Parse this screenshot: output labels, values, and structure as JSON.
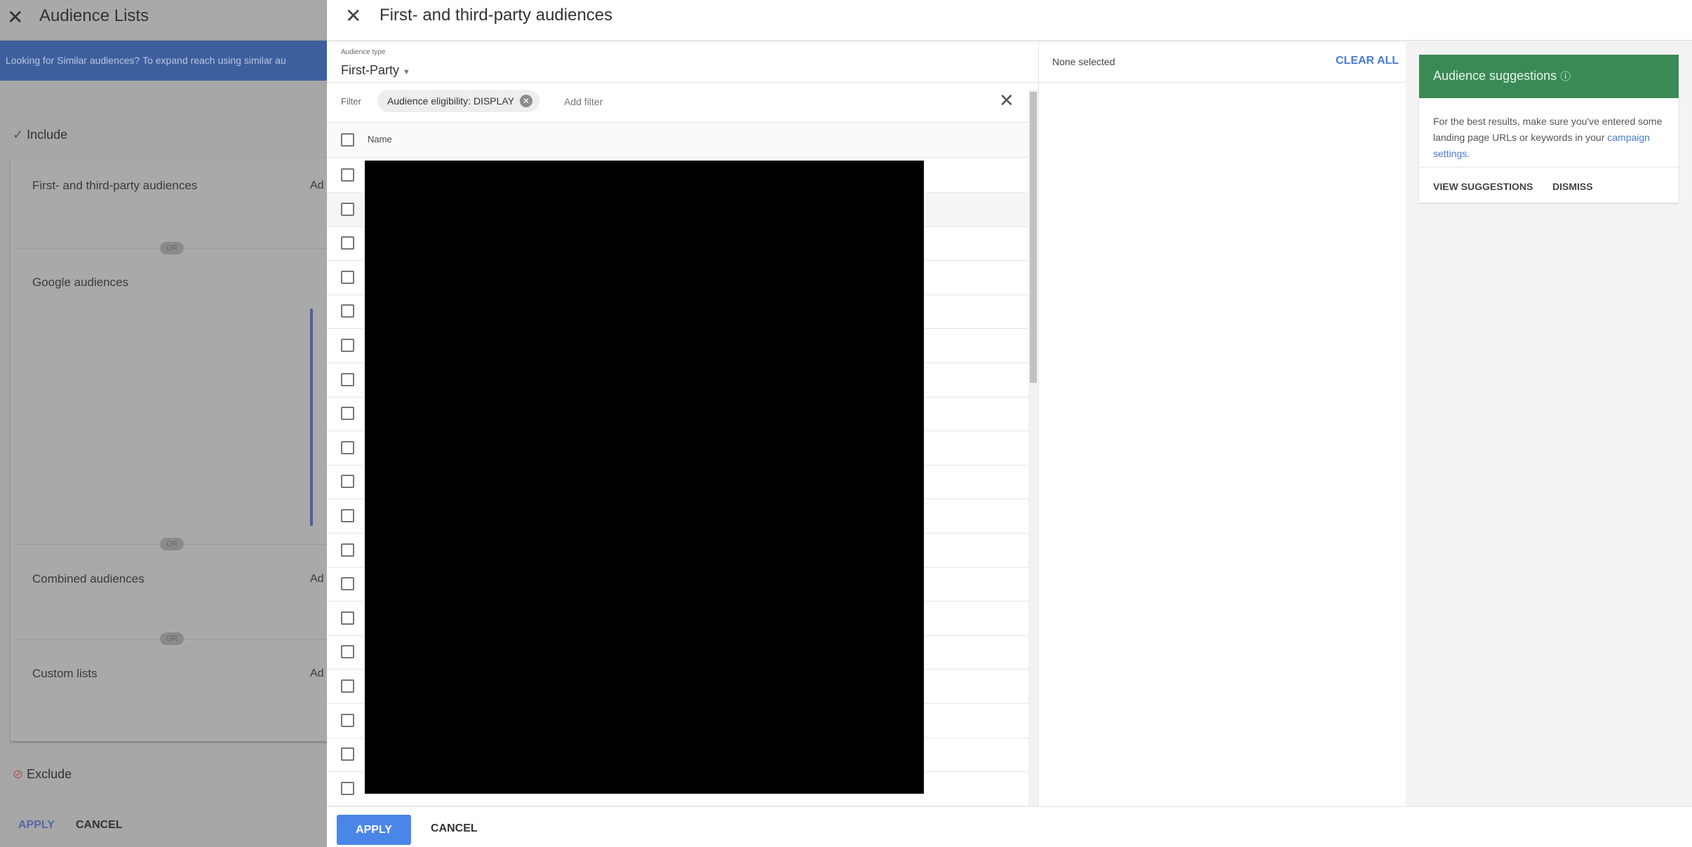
{
  "background_panel": {
    "title": "Audience Lists",
    "banner_text": "Looking for Similar audiences? To expand reach using similar au",
    "include_label": "Include",
    "sections": [
      {
        "label": "First- and third-party audiences",
        "action": "Ad"
      },
      {
        "label": "Google audiences",
        "action": ""
      },
      {
        "label": "Combined audiences",
        "action": "Ad"
      },
      {
        "label": "Custom lists",
        "action": "Ad"
      }
    ],
    "or_label": "OR",
    "exclude_label": "Exclude",
    "apply_label": "APPLY",
    "cancel_label": "CANCEL"
  },
  "dialog": {
    "title": "First- and third-party audiences",
    "audience_type_label": "Audience type",
    "audience_type_value": "First-Party",
    "filter_label": "Filter",
    "filter_chip": "Audience eligibility: DISPLAY",
    "add_filter": "Add filter",
    "column_name": "Name",
    "rows": [
      {
        "checked": false
      },
      {
        "checked": false
      },
      {
        "checked": false
      },
      {
        "checked": false
      },
      {
        "checked": false
      },
      {
        "checked": false
      },
      {
        "checked": false
      },
      {
        "checked": false
      },
      {
        "checked": false
      },
      {
        "checked": false
      },
      {
        "checked": false
      },
      {
        "checked": false
      },
      {
        "checked": false
      },
      {
        "checked": false
      },
      {
        "checked": false
      },
      {
        "checked": false
      },
      {
        "checked": false
      },
      {
        "checked": false
      },
      {
        "checked": false
      }
    ],
    "selection_status": "None selected",
    "clear_all": "CLEAR ALL",
    "suggestions": {
      "title": "Audience suggestions",
      "body": "For the best results, make sure you've entered some landing page URLs or keywords in your ",
      "link": "campaign settings",
      "link_suffix": ".",
      "view": "VIEW SUGGESTIONS",
      "dismiss": "DISMISS",
      "header_color": "#3a8a55"
    },
    "apply_label": "APPLY",
    "cancel_label": "CANCEL",
    "accent_color": "#4a86e8"
  }
}
